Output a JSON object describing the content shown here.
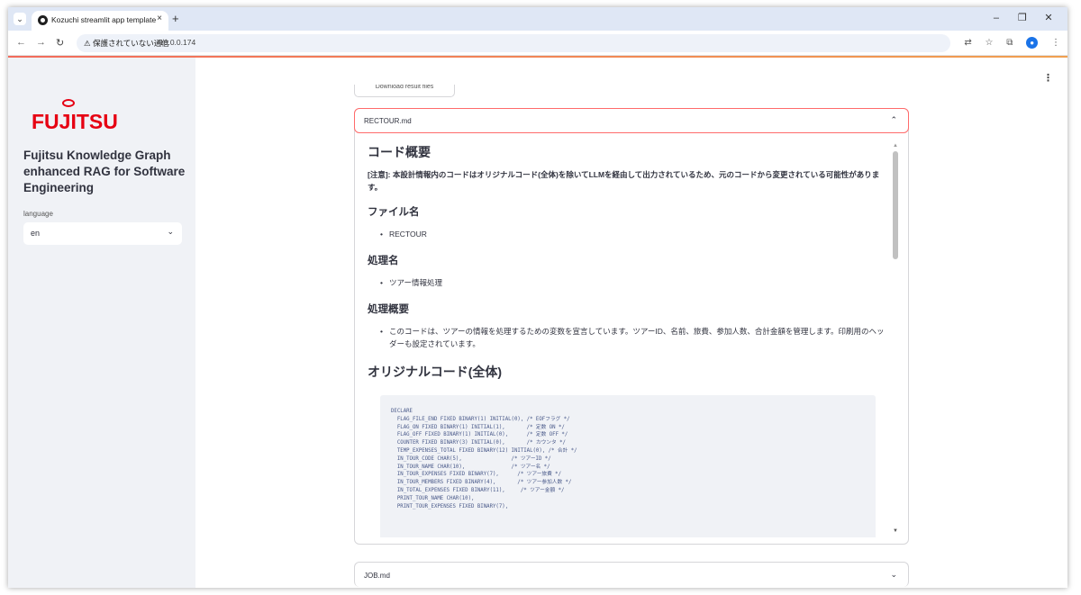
{
  "browser": {
    "tab_title": "Kozuchi streamlit app template",
    "tab_close": "×",
    "new_tab": "+",
    "window_controls": [
      "–",
      "❐",
      "✕"
    ],
    "security_warning": "⚠ 保護されていない通信",
    "url": "10.0.0.174"
  },
  "sidebar": {
    "logo_text": "FUJITSU",
    "title": "Fujitsu Knowledge Graph enhanced RAG for Software Engineering",
    "language_label": "language",
    "language_value": "en"
  },
  "main": {
    "download_button": "Download result files",
    "expander_open": {
      "title": "RECTOUR.md",
      "heading": "コード概要",
      "note": "[注意]: 本設計情報内のコードはオリジナルコード(全体)を除いてLLMを経由して出力されているため、元のコードから変更されている可能性があります。",
      "file_heading": "ファイル名",
      "file_name": "RECTOUR",
      "process_heading": "処理名",
      "process_name": "ツアー情報処理",
      "summary_heading": "処理概要",
      "summary_text": "このコードは、ツアーの情報を処理するための変数を宣言しています。ツアーID、名前、旅費、参加人数、合計金額を管理します。印刷用のヘッダーも設定されています。",
      "original_heading": "オリジナルコード(全体)",
      "code": "DECLARE\n  FLAG_FILE_END FIXED BINARY(1) INITIAL(0), /* EOFフラグ */\n  FLAG_ON FIXED BINARY(1) INITIAL(1),       /* 定数 ON */\n  FLAG_OFF FIXED BINARY(1) INITIAL(0),      /* 定数 OFF */\n  COUNTER FIXED BINARY(3) INITIAL(0),       /* カウンタ */\n  TEMP_EXPENSES_TOTAL FIXED BINARY(12) INITIAL(0), /* 合計 */\n  IN_TOUR_CODE CHAR(5),                /* ツアーID */\n  IN_TOUR_NAME CHAR(10),               /* ツアー名 */\n  IN_TOUR_EXPENSES FIXED BINARY(7),      /* ツアー旅費 */\n  IN_TOUR_MEMBERS FIXED BINARY(4),       /* ツアー参加人数 */\n  IN_TOTAL_EXPENSES FIXED BINARY(11),     /* ツアー金額 */\n  PRINT_TOUR_NAME CHAR(10),\n  PRINT_TOUR_EXPENSES FIXED BINARY(7),"
    },
    "expander_closed": {
      "title": "JOB.md"
    }
  }
}
